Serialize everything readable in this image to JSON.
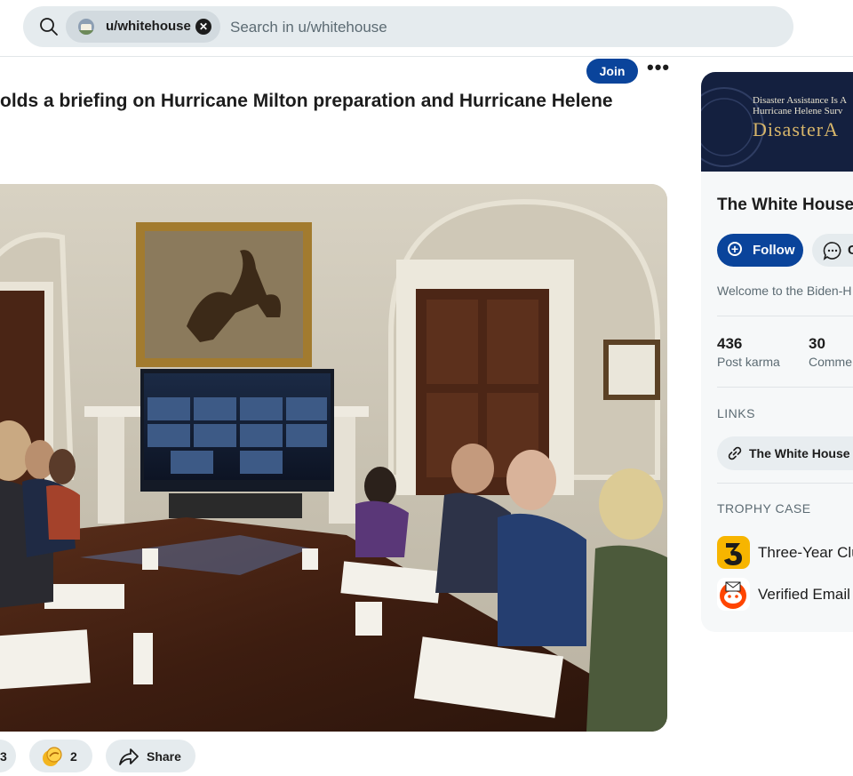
{
  "search": {
    "chip_label": "u/whitehouse",
    "placeholder": "Search in u/whitehouse"
  },
  "post": {
    "join_label": "Join",
    "more_label": "•••",
    "title": "olds a briefing on Hurricane Milton preparation and Hurricane Helene",
    "actions": {
      "score": "3",
      "awards_count": "2",
      "share_label": "Share"
    }
  },
  "sidebar": {
    "banner_line1": "Disaster Assistance Is A",
    "banner_line2": "Hurricane Helene Surv",
    "banner_title": "DisasterA",
    "name": "The White House",
    "follow_label": "Follow",
    "chat_label": "C",
    "welcome": "Welcome to the Biden-H",
    "stats": [
      {
        "value": "436",
        "label": "Post karma"
      },
      {
        "value": "30",
        "label": "Comme"
      }
    ],
    "links_header": "LINKS",
    "link_label": "The White House",
    "trophy_header": "TROPHY CASE",
    "trophies": [
      {
        "label": "Three-Year Clu",
        "icon": "three-year-club-icon",
        "color": "#f7b500"
      },
      {
        "label": "Verified Email",
        "icon": "verified-email-icon",
        "color": "#ff4500"
      }
    ]
  },
  "colors": {
    "primary_button": "#0a449b",
    "search_bg": "#e5ebee",
    "muted_text": "#5c6b73"
  }
}
